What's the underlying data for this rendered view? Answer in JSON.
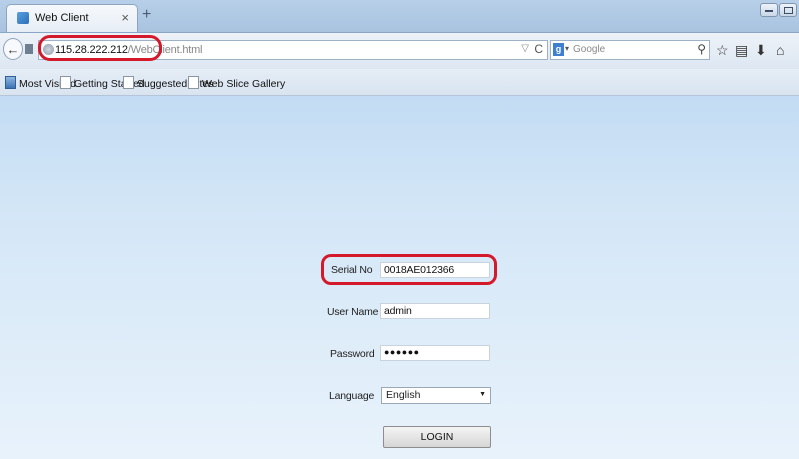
{
  "browser": {
    "tab_title": "Web Client",
    "tab_close": "×",
    "new_tab": "+",
    "back_glyph": "←",
    "url_host": "115.28.222.212",
    "url_path": "/WebClient.html",
    "url_dropdown": "▽",
    "reload_glyph": "C",
    "search_engine_glyph": "g",
    "search_dropdown_glyph": "▾",
    "search_placeholder": "Google",
    "search_glyph": "⚲",
    "star_glyph": "☆",
    "clipboard_glyph": "▤",
    "download_glyph": "⬇",
    "home_glyph": "⌂"
  },
  "bookmarks": [
    {
      "label": "Most Visited"
    },
    {
      "label": "Getting Started"
    },
    {
      "label": "Suggested Sites"
    },
    {
      "label": "Web Slice Gallery"
    }
  ],
  "form": {
    "serial_label": "Serial No",
    "serial_value": "0018AE012366",
    "user_label": "User Name",
    "user_value": "admin",
    "password_label": "Password",
    "password_value": "●●●●●●",
    "language_label": "Language",
    "language_value": "English",
    "language_caret": "▼",
    "login_label": "LOGIN"
  },
  "colors": {
    "highlight": "#d3192a",
    "page_background": "#c3dcf3"
  },
  "icons": [
    "favicon-icon",
    "globe-icon",
    "google-icon",
    "search-icon",
    "bookmark-star-icon",
    "clipboard-icon",
    "download-icon",
    "home-icon"
  ]
}
